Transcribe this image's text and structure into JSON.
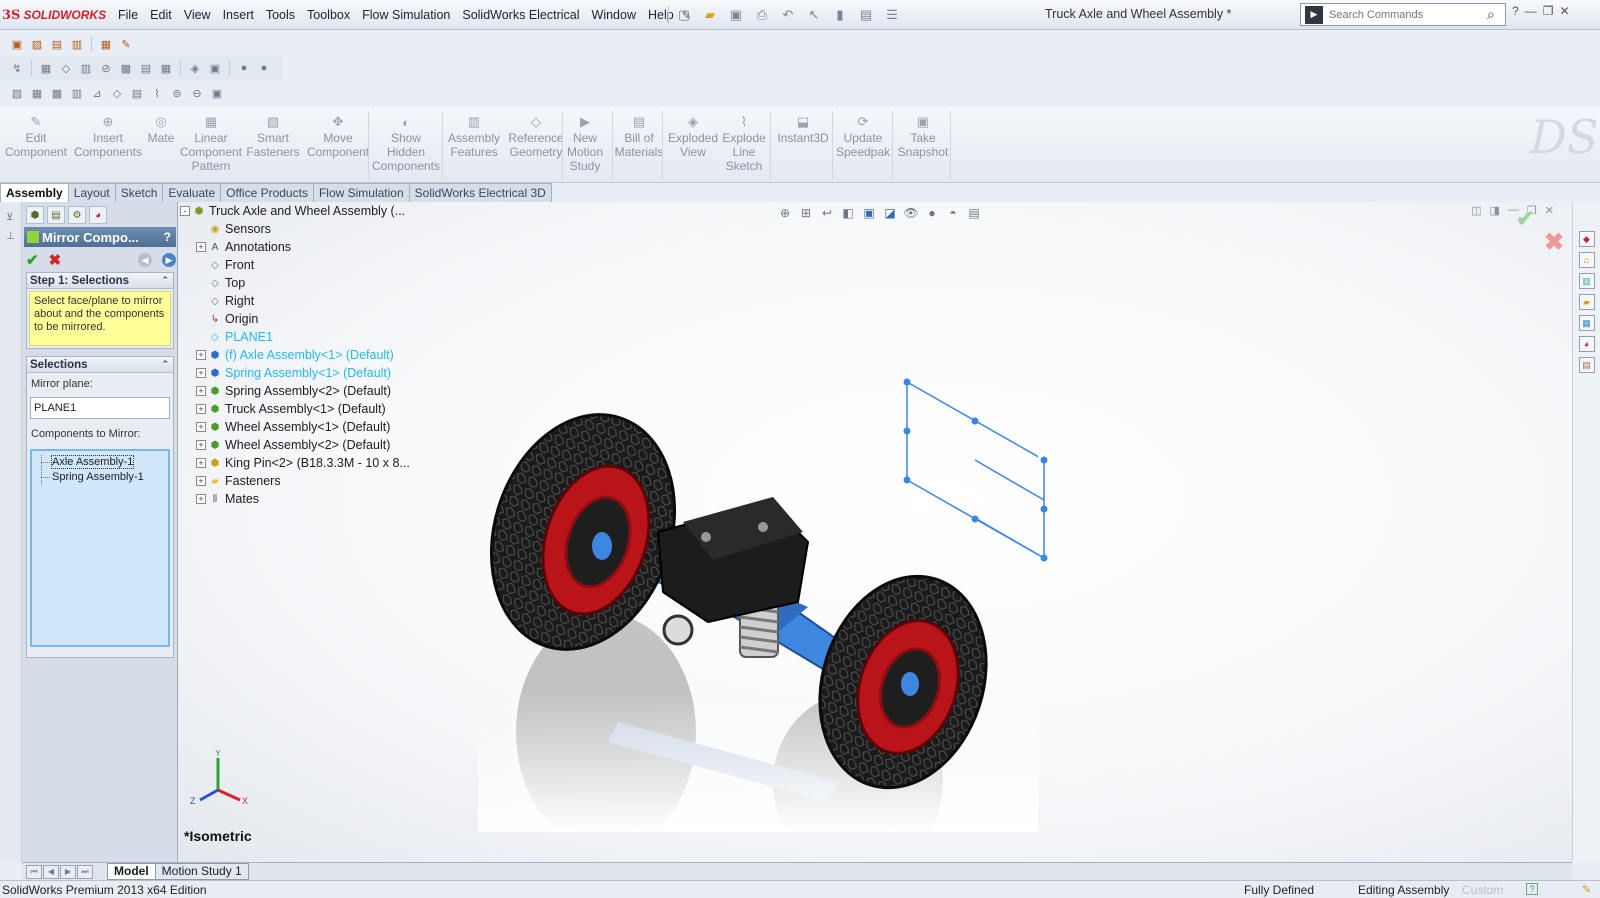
{
  "app": {
    "logo_ds": "3S",
    "logo_name": "SOLIDWORKS",
    "document_title": "Truck Axle and Wheel Assembly *"
  },
  "menu": [
    "File",
    "Edit",
    "View",
    "Insert",
    "Tools",
    "Toolbox",
    "Flow Simulation",
    "SolidWorks Electrical",
    "Window",
    "Help"
  ],
  "search": {
    "placeholder": "Search Commands"
  },
  "command_manager": [
    {
      "label": "Edit\nComponent",
      "icon": "edit-component-icon"
    },
    {
      "label": "Insert\nComponents",
      "icon": "insert-components-icon"
    },
    {
      "label": "Mate",
      "icon": "mate-icon"
    },
    {
      "label": "Linear\nComponent\nPattern",
      "icon": "linear-pattern-icon"
    },
    {
      "label": "Smart\nFasteners",
      "icon": "smart-fasteners-icon"
    },
    {
      "label": "Move\nComponent",
      "icon": "move-component-icon"
    },
    {
      "label": "Show\nHidden\nComponents",
      "icon": "show-hidden-icon"
    },
    {
      "label": "Assembly\nFeatures",
      "icon": "assembly-features-icon"
    },
    {
      "label": "Reference\nGeometry",
      "icon": "reference-geometry-icon"
    },
    {
      "label": "New\nMotion\nStudy",
      "icon": "motion-study-icon"
    },
    {
      "label": "Bill of\nMaterials",
      "icon": "bom-icon"
    },
    {
      "label": "Exploded\nView",
      "icon": "exploded-view-icon"
    },
    {
      "label": "Explode\nLine\nSketch",
      "icon": "explode-line-icon"
    },
    {
      "label": "Instant3D",
      "icon": "instant3d-icon"
    },
    {
      "label": "Update\nSpeedpak",
      "icon": "speedpak-icon"
    },
    {
      "label": "Take\nSnapshot",
      "icon": "snapshot-icon"
    }
  ],
  "tabs": [
    "Assembly",
    "Layout",
    "Sketch",
    "Evaluate",
    "Office Products",
    "Flow Simulation",
    "SolidWorks Electrical 3D"
  ],
  "property_manager": {
    "title": "Mirror Compo...",
    "help": "?",
    "step1_title": "Step 1: Selections",
    "step1_message": "Select face/plane to mirror about and the components to be mirrored.",
    "selections_title": "Selections",
    "mirror_plane_label": "Mirror plane:",
    "mirror_plane_value": "PLANE1",
    "components_label": "Components to Mirror:",
    "components": [
      "Axle Assembly-1",
      "Spring Assembly-1"
    ]
  },
  "feature_tree": [
    {
      "label": "Truck Axle and Wheel Assembly  (...",
      "icon": "assembly-icon",
      "expand": "-",
      "selected": false,
      "indent": 0
    },
    {
      "label": "Sensors",
      "icon": "sensors-icon",
      "expand": "",
      "selected": false,
      "indent": 1
    },
    {
      "label": "Annotations",
      "icon": "annotations-icon",
      "expand": "+",
      "selected": false,
      "indent": 1
    },
    {
      "label": "Front",
      "icon": "plane-icon",
      "expand": "",
      "selected": false,
      "indent": 1
    },
    {
      "label": "Top",
      "icon": "plane-icon",
      "expand": "",
      "selected": false,
      "indent": 1
    },
    {
      "label": "Right",
      "icon": "plane-icon",
      "expand": "",
      "selected": false,
      "indent": 1
    },
    {
      "label": "Origin",
      "icon": "origin-icon",
      "expand": "",
      "selected": false,
      "indent": 1
    },
    {
      "label": "PLANE1",
      "icon": "plane-icon",
      "expand": "",
      "selected": true,
      "indent": 1
    },
    {
      "label": "(f) Axle Assembly<1> (Default)",
      "icon": "subassembly-icon",
      "expand": "+",
      "selected": true,
      "indent": 1
    },
    {
      "label": "Spring Assembly<1> (Default)",
      "icon": "subassembly-icon",
      "expand": "+",
      "selected": true,
      "indent": 1
    },
    {
      "label": "Spring Assembly<2> (Default)",
      "icon": "subassembly-icon",
      "expand": "+",
      "selected": false,
      "indent": 1
    },
    {
      "label": "Truck Assembly<1> (Default)",
      "icon": "subassembly-icon",
      "expand": "+",
      "selected": false,
      "indent": 1
    },
    {
      "label": "Wheel Assembly<1> (Default)",
      "icon": "subassembly-icon",
      "expand": "+",
      "selected": false,
      "indent": 1
    },
    {
      "label": "Wheel Assembly<2> (Default)",
      "icon": "subassembly-icon",
      "expand": "+",
      "selected": false,
      "indent": 1
    },
    {
      "label": "King Pin<2> (B18.3.3M - 10 x 8...",
      "icon": "part-icon",
      "expand": "+",
      "selected": false,
      "indent": 1
    },
    {
      "label": "Fasteners",
      "icon": "folder-icon",
      "expand": "+",
      "selected": false,
      "indent": 1
    },
    {
      "label": "Mates",
      "icon": "mates-icon",
      "expand": "+",
      "selected": false,
      "indent": 1
    }
  ],
  "viewport": {
    "view_name": "*Isometric",
    "triad": {
      "x": "X",
      "y": "Y",
      "z": "Z"
    }
  },
  "bottom_tabs": [
    "Model",
    "Motion Study 1"
  ],
  "status": {
    "edition": "SolidWorks Premium 2013 x64 Edition",
    "state": "Fully Defined",
    "mode": "Editing Assembly",
    "units": "Custom",
    "help": "?"
  },
  "colors": {
    "selection": "#25b7f0",
    "axle": "#3f86e0",
    "rim": "#c0191c",
    "tire": "#141414",
    "ok": "#2aa32a",
    "cancel": "#d42424"
  }
}
